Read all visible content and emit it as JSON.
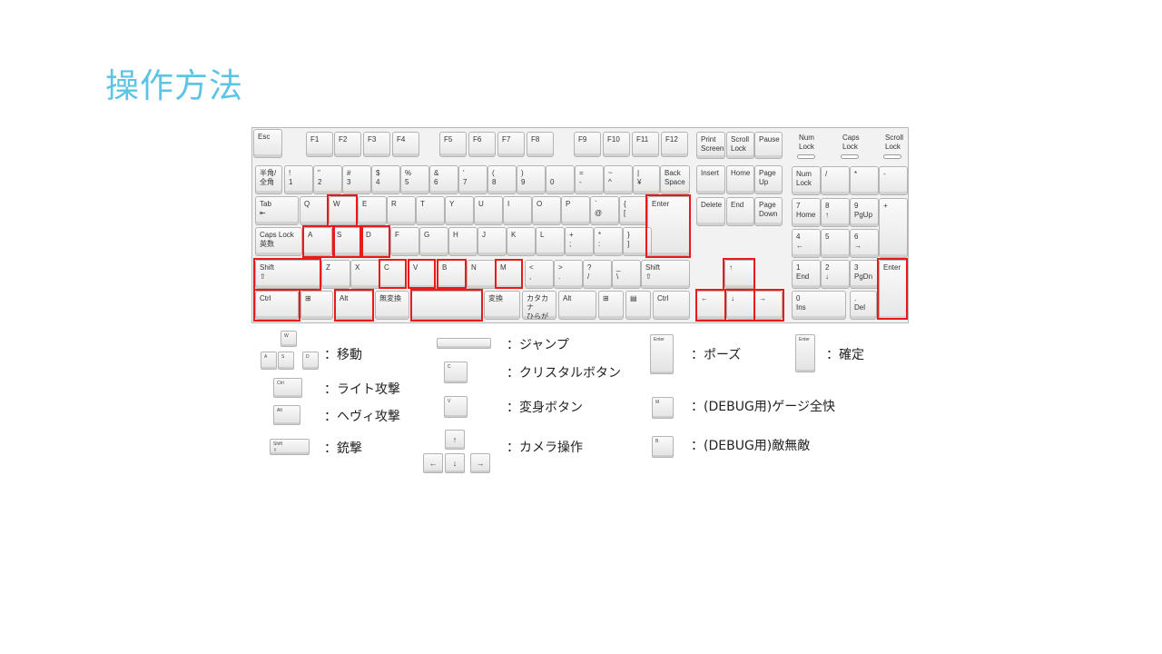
{
  "slide": {
    "title": "操作方法"
  },
  "keyboard": {
    "keys": [
      {
        "id": "esc",
        "label": "Esc"
      },
      {
        "id": "f1",
        "label": "F1"
      },
      {
        "id": "f2",
        "label": "F2"
      },
      {
        "id": "f3",
        "label": "F3"
      },
      {
        "id": "f4",
        "label": "F4"
      },
      {
        "id": "f5",
        "label": "F5"
      },
      {
        "id": "f6",
        "label": "F6"
      },
      {
        "id": "f7",
        "label": "F7"
      },
      {
        "id": "f8",
        "label": "F8"
      },
      {
        "id": "f9",
        "label": "F9"
      },
      {
        "id": "f10",
        "label": "F10"
      },
      {
        "id": "f11",
        "label": "F11"
      },
      {
        "id": "f12",
        "label": "F12"
      },
      {
        "id": "printscreen",
        "label": "Print\nScreen"
      },
      {
        "id": "scrolllock",
        "label": "Scroll\nLock"
      },
      {
        "id": "pause",
        "label": "Pause"
      },
      {
        "id": "hankaku",
        "label": "半角/\n全角"
      },
      {
        "id": "1",
        "label": "!\n1"
      },
      {
        "id": "2",
        "label": "\"\n2"
      },
      {
        "id": "3",
        "label": "#\n3"
      },
      {
        "id": "4",
        "label": "$\n4"
      },
      {
        "id": "5",
        "label": "%\n5"
      },
      {
        "id": "6",
        "label": "&\n6"
      },
      {
        "id": "7",
        "label": "'\n7"
      },
      {
        "id": "8",
        "label": "(\n8"
      },
      {
        "id": "9",
        "label": ")\n9"
      },
      {
        "id": "0",
        "label": "\n0"
      },
      {
        "id": "minus",
        "label": "=\n-"
      },
      {
        "id": "caret",
        "label": "~\n^"
      },
      {
        "id": "yen",
        "label": "|\n¥"
      },
      {
        "id": "backspace",
        "label": "Back\nSpace"
      },
      {
        "id": "insert",
        "label": "Insert"
      },
      {
        "id": "home",
        "label": "Home"
      },
      {
        "id": "pageup",
        "label": "Page\nUp"
      },
      {
        "id": "numlock",
        "label": "Num\nLock"
      },
      {
        "id": "npdiv",
        "label": "/"
      },
      {
        "id": "npmul",
        "label": "*"
      },
      {
        "id": "npminus",
        "label": "-"
      },
      {
        "id": "tab",
        "label": "Tab\n⇤"
      },
      {
        "id": "q",
        "label": "Q"
      },
      {
        "id": "w",
        "label": "W"
      },
      {
        "id": "e",
        "label": "E"
      },
      {
        "id": "r",
        "label": "R"
      },
      {
        "id": "t",
        "label": "T"
      },
      {
        "id": "y",
        "label": "Y"
      },
      {
        "id": "u",
        "label": "U"
      },
      {
        "id": "i",
        "label": "I"
      },
      {
        "id": "o",
        "label": "O"
      },
      {
        "id": "p",
        "label": "P"
      },
      {
        "id": "at",
        "label": "`\n@"
      },
      {
        "id": "lbrace",
        "label": "{\n["
      },
      {
        "id": "enter",
        "label": "Enter"
      },
      {
        "id": "delete",
        "label": "Delete"
      },
      {
        "id": "end",
        "label": "End"
      },
      {
        "id": "pagedown",
        "label": "Page\nDown"
      },
      {
        "id": "np7",
        "label": "7\nHome"
      },
      {
        "id": "np8",
        "label": "8\n↑"
      },
      {
        "id": "np9",
        "label": "9\nPgUp"
      },
      {
        "id": "npplus",
        "label": "+"
      },
      {
        "id": "capslock",
        "label": "Caps Lock\n英数"
      },
      {
        "id": "a",
        "label": "A"
      },
      {
        "id": "s",
        "label": "S"
      },
      {
        "id": "d",
        "label": "D"
      },
      {
        "id": "f",
        "label": "F"
      },
      {
        "id": "g",
        "label": "G"
      },
      {
        "id": "h",
        "label": "H"
      },
      {
        "id": "j",
        "label": "J"
      },
      {
        "id": "k",
        "label": "K"
      },
      {
        "id": "l",
        "label": "L"
      },
      {
        "id": "semicolon",
        "label": "+\n;"
      },
      {
        "id": "colon",
        "label": "*\n:"
      },
      {
        "id": "rbrace",
        "label": "}\n]"
      },
      {
        "id": "np4",
        "label": "4\n←"
      },
      {
        "id": "np5",
        "label": "5"
      },
      {
        "id": "np6",
        "label": "6\n→"
      },
      {
        "id": "lshift",
        "label": "Shift\n⇧"
      },
      {
        "id": "z",
        "label": "Z"
      },
      {
        "id": "x",
        "label": "X"
      },
      {
        "id": "c",
        "label": "C"
      },
      {
        "id": "v",
        "label": "V"
      },
      {
        "id": "b",
        "label": "B"
      },
      {
        "id": "n",
        "label": "N"
      },
      {
        "id": "m",
        "label": "M"
      },
      {
        "id": "comma",
        "label": "<\n,"
      },
      {
        "id": "period",
        "label": ">\n."
      },
      {
        "id": "slash",
        "label": "?\n/"
      },
      {
        "id": "backslash",
        "label": "_\n\\"
      },
      {
        "id": "rshift",
        "label": "Shift\n⇧"
      },
      {
        "id": "up",
        "label": "↑"
      },
      {
        "id": "np1",
        "label": "1\nEnd"
      },
      {
        "id": "np2",
        "label": "2\n↓"
      },
      {
        "id": "np3",
        "label": "3\nPgDn"
      },
      {
        "id": "npenter",
        "label": "Enter"
      },
      {
        "id": "lctrl",
        "label": "Ctrl"
      },
      {
        "id": "lwin",
        "label": "⊞"
      },
      {
        "id": "lalt",
        "label": "Alt"
      },
      {
        "id": "muhenkan",
        "label": "無変換"
      },
      {
        "id": "space",
        "label": ""
      },
      {
        "id": "henkan",
        "label": "変換"
      },
      {
        "id": "kana",
        "label": "カタカナ\nひらがな"
      },
      {
        "id": "ralt",
        "label": "Alt"
      },
      {
        "id": "rwin",
        "label": "⊞"
      },
      {
        "id": "menu",
        "label": "▤"
      },
      {
        "id": "rctrl",
        "label": "Ctrl"
      },
      {
        "id": "left",
        "label": "←"
      },
      {
        "id": "down",
        "label": "↓"
      },
      {
        "id": "right",
        "label": "→"
      },
      {
        "id": "np0",
        "label": "0\nIns"
      },
      {
        "id": "npdot",
        "label": ".\nDel"
      }
    ],
    "indicators": [
      {
        "id": "num",
        "label": "Num\nLock"
      },
      {
        "id": "caps",
        "label": "Caps\nLock"
      },
      {
        "id": "scroll",
        "label": "Scroll\nLock"
      }
    ],
    "highlighted": [
      "w",
      "a",
      "s",
      "d",
      "c",
      "v",
      "b",
      "m",
      "lshift",
      "lctrl",
      "lalt",
      "space",
      "enter",
      "up",
      "left",
      "down",
      "right",
      "npenter"
    ]
  },
  "legend": [
    {
      "id": "move",
      "text": "：移動",
      "keys": [
        {
          "k": "W"
        },
        {
          "k": "A"
        },
        {
          "k": "S"
        },
        {
          "k": "D"
        }
      ]
    },
    {
      "id": "light",
      "text": "：ライト攻撃",
      "keys": [
        {
          "k": "Ctrl"
        }
      ]
    },
    {
      "id": "heavy",
      "text": "：ヘヴィ攻撃",
      "keys": [
        {
          "k": "Alt"
        }
      ]
    },
    {
      "id": "gun",
      "text": "：銃撃",
      "keys": [
        {
          "k": "Shift\n⇧"
        }
      ]
    },
    {
      "id": "jump",
      "text": "：ジャンプ",
      "keys": [
        {
          "k": ""
        }
      ]
    },
    {
      "id": "crystal",
      "text": "：クリスタルボタン",
      "keys": [
        {
          "k": "C"
        }
      ]
    },
    {
      "id": "transform",
      "text": "：変身ボタン",
      "keys": [
        {
          "k": "V"
        }
      ]
    },
    {
      "id": "camera",
      "text": "：カメラ操作",
      "keys": [
        {
          "k": "↑"
        },
        {
          "k": "←"
        },
        {
          "k": "↓"
        },
        {
          "k": "→"
        }
      ]
    },
    {
      "id": "pause",
      "text": "：ポーズ",
      "keys": [
        {
          "k": "Enter"
        }
      ]
    },
    {
      "id": "confirm",
      "text": "：確定",
      "keys": [
        {
          "k": "Enter"
        }
      ]
    },
    {
      "id": "debug-gauge",
      "text": "：(DEBUG用)ゲージ全快",
      "keys": [
        {
          "k": "M"
        }
      ]
    },
    {
      "id": "debug-invincible",
      "text": "：(DEBUG用)敵無敵",
      "keys": [
        {
          "k": "B"
        }
      ]
    }
  ]
}
